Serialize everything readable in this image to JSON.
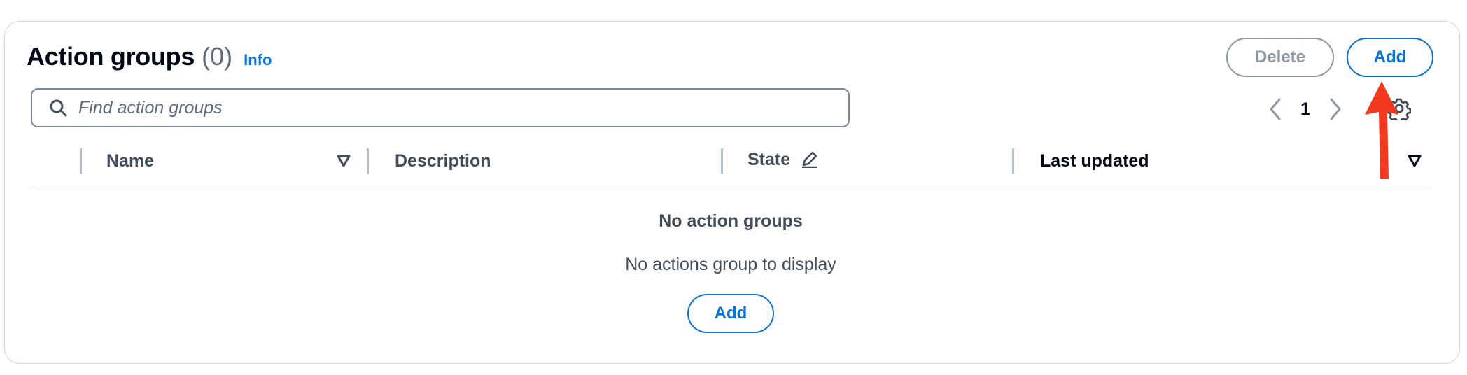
{
  "header": {
    "title": "Action groups",
    "count": "(0)",
    "info_label": "Info"
  },
  "actions": {
    "delete_label": "Delete",
    "add_label": "Add"
  },
  "search": {
    "placeholder": "Find action groups",
    "icon": "search-icon"
  },
  "pagination": {
    "current_page": "1",
    "prev_icon": "chevron-left-icon",
    "next_icon": "chevron-right-icon",
    "settings_icon": "gear-icon"
  },
  "table": {
    "columns": [
      {
        "label": "Name",
        "sortable": true
      },
      {
        "label": "Description",
        "sortable": false
      },
      {
        "label": "State",
        "editable": true
      },
      {
        "label": "Last updated",
        "sortable": true
      }
    ]
  },
  "empty_state": {
    "title": "No action groups",
    "description": "No actions group to display",
    "add_label": "Add"
  },
  "annotation": {
    "color": "#f33a21",
    "icon": "red-arrow-annotation"
  },
  "colors": {
    "accent": "#0972d3",
    "disabled": "#8c97a4",
    "text": "#000716",
    "muted": "#414d5c"
  }
}
